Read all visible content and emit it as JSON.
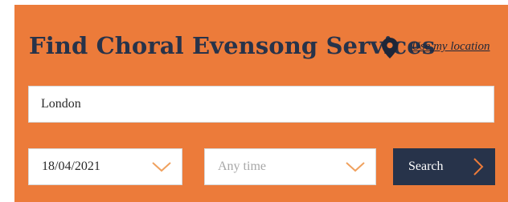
{
  "header": {
    "title": "Find Choral Evensong Services",
    "use_location_label": "Use my location"
  },
  "search": {
    "location_value": "London",
    "date_value": "18/04/2021",
    "time_value": "Any time",
    "button_label": "Search"
  },
  "colors": {
    "panel_background": "#ec7b3a",
    "accent_navy": "#27334a",
    "chevron_orange": "#f0a15e"
  },
  "icons": {
    "location": "map-pin-icon",
    "dropdown": "chevron-down-icon",
    "submit": "chevron-right-icon"
  }
}
